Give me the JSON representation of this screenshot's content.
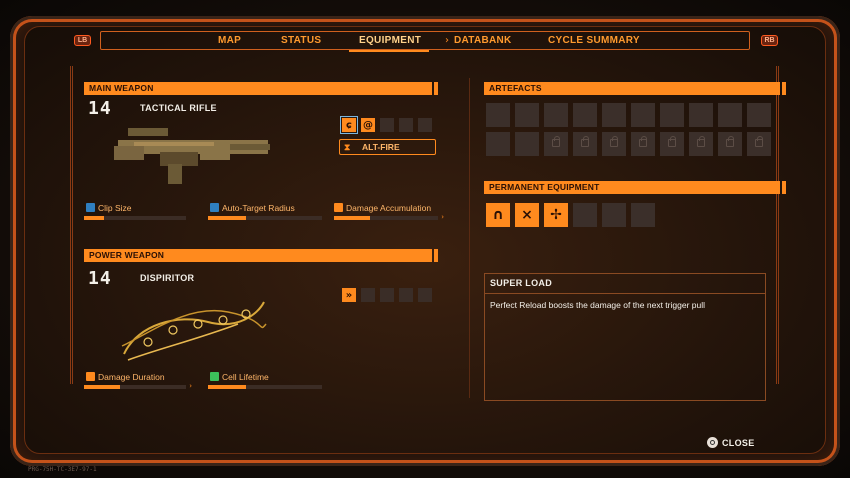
{
  "nav": {
    "left_bumper": "LB",
    "right_bumper": "RB",
    "tabs": [
      "MAP",
      "STATUS",
      "EQUIPMENT",
      "DATABANK",
      "CYCLE SUMMARY"
    ],
    "active_tab": "EQUIPMENT"
  },
  "main_weapon": {
    "header": "MAIN WEAPON",
    "level": "14",
    "name": "TACTICAL RIFLE",
    "alt_fire_label": "ALT-FIRE",
    "traits": [
      {
        "label": "Clip Size",
        "icon": "crosshair-blue-icon",
        "fill": 0.2
      },
      {
        "label": "Auto-Target Radius",
        "icon": "target-blue-icon",
        "fill": 0.33
      },
      {
        "label": "Damage Accumulation",
        "icon": "chevron-orange-icon",
        "fill": 0.35
      }
    ]
  },
  "power_weapon": {
    "header": "POWER WEAPON",
    "level": "14",
    "name": "DISPIRITOR",
    "traits": [
      {
        "label": "Damage Duration",
        "icon": "chevron-orange-icon",
        "fill": 0.35
      },
      {
        "label": "Cell Lifetime",
        "icon": "plus-green-icon",
        "fill": 0.33
      }
    ]
  },
  "artefacts": {
    "header": "ARTEFACTS"
  },
  "permanent_equipment": {
    "header": "PERMANENT EQUIPMENT"
  },
  "info": {
    "title": "SUPER LOAD",
    "text": "Perfect Reload boosts the damage of the next trigger pull"
  },
  "close_label": "CLOSE",
  "footer_code": "PRG-75H-TC-3E7-97-1",
  "colors": {
    "accent": "#ff8a1e",
    "background": "#25150b",
    "slot_empty": "#3b2f2a"
  }
}
